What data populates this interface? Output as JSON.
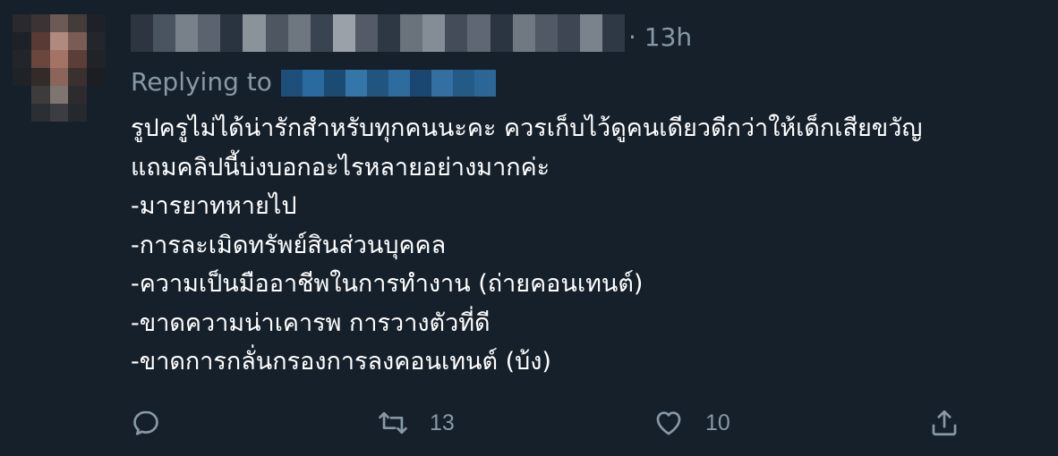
{
  "tweet": {
    "time": "· 13h",
    "replying_label": "Replying to",
    "lines": [
      "รูปครูไม่ได้น่ารักสำหรับทุกคนนะคะ ควรเก็บไว้ดูคนเดียวดีกว่าให้เด็กเสียขวัญ",
      "แถมคลิปนี้บ่งบอกอะไรหลายอย่างมากค่ะ",
      "-มารยาทหายไป",
      "-การละเมิดทรัพย์สินส่วนบุคคล",
      "-ความเป็นมืออาชีพในการทำงาน (ถ่ายคอนเทนต์)",
      "-ขาดความน่าเคารพ การวางตัวที่ดี",
      "-ขาดการกลั่นกรองการลงคอนเทนต์ (บ้ง)"
    ]
  },
  "actions": {
    "reply_icon": "reply-icon",
    "retweet_icon": "retweet-icon",
    "retweet_count": "13",
    "like_icon": "heart-icon",
    "like_count": "10",
    "share_icon": "share-icon"
  },
  "colors": {
    "background": "#15202b",
    "text": "#ffffff",
    "secondary_text": "#8899a6",
    "icon": "#8899a6"
  }
}
